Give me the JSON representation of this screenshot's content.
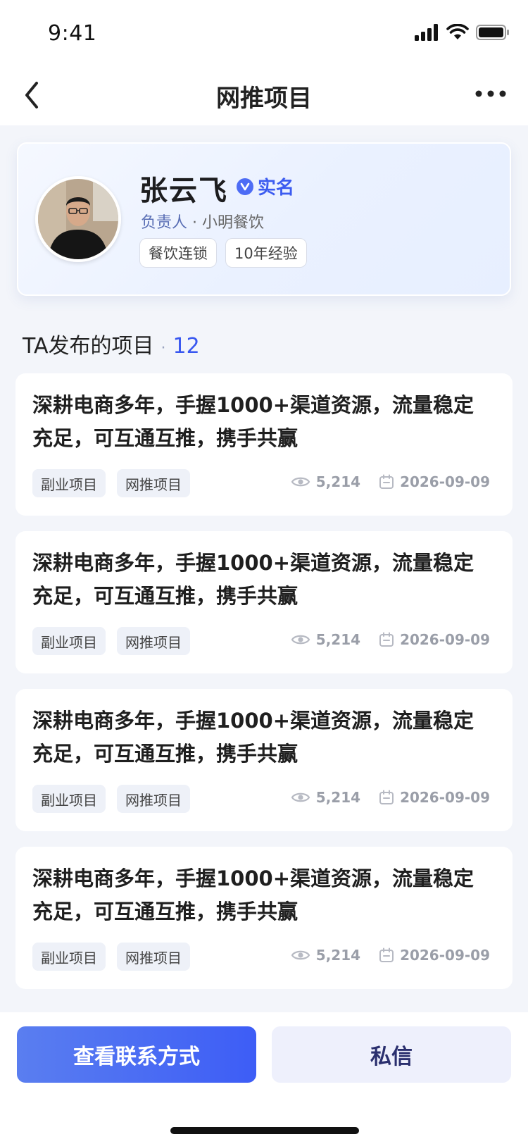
{
  "status_bar": {
    "time": "9:41"
  },
  "nav": {
    "title": "网推项目"
  },
  "profile": {
    "name": "张云飞",
    "verified_label": "实名",
    "role": "负责人",
    "separator": "·",
    "company": "小明餐饮",
    "tags": [
      "餐饮连锁",
      "10年经验"
    ]
  },
  "section": {
    "title": "TA发布的项目",
    "dot": "·",
    "count": "12"
  },
  "projects": [
    {
      "title": "深耕电商多年，手握1000+渠道资源，流量稳定充足，可互通互推，携手共赢",
      "tags": [
        "副业项目",
        "网推项目"
      ],
      "views": "5,214",
      "date": "2026-09-09"
    },
    {
      "title": "深耕电商多年，手握1000+渠道资源，流量稳定充足，可互通互推，携手共赢",
      "tags": [
        "副业项目",
        "网推项目"
      ],
      "views": "5,214",
      "date": "2026-09-09"
    },
    {
      "title": "深耕电商多年，手握1000+渠道资源，流量稳定充足，可互通互推，携手共赢",
      "tags": [
        "副业项目",
        "网推项目"
      ],
      "views": "5,214",
      "date": "2026-09-09"
    },
    {
      "title": "深耕电商多年，手握1000+渠道资源，流量稳定充足，可互通互推，携手共赢",
      "tags": [
        "副业项目",
        "网推项目"
      ],
      "views": "5,214",
      "date": "2026-09-09"
    }
  ],
  "actions": {
    "contact": "查看联系方式",
    "message": "私信"
  },
  "icons": {
    "back": "chevron-left-icon",
    "more": "more-dots-icon",
    "verified": "verified-v-icon",
    "views": "eye-icon",
    "date": "calendar-icon",
    "signal": "signal-icon",
    "wifi": "wifi-icon",
    "battery": "battery-icon"
  },
  "colors": {
    "accent": "#3d5df6",
    "verified": "#4d6cf5",
    "page_bg": "#f3f5fa"
  }
}
